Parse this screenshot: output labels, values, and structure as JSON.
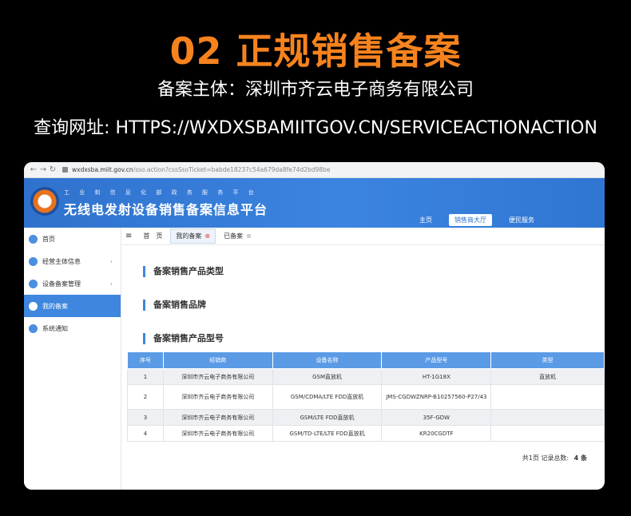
{
  "heading": "02 正规销售备案",
  "entity_line": "备案主体：深圳市齐云电子商务有限公司",
  "query_line": "查询网址: HTTPS://WXDXSBAMIITGOV.CN/SERVICEACTIONACTION",
  "browser": {
    "url_host": "wxdxsba.miit.gov.cn",
    "url_path": "/sso.action?cssSsoTicket=babde18237c54a679da8fe74d2bd98be"
  },
  "banner": {
    "small_text": "工 业 和 信 息 化 部 政 务 服 务 平 台",
    "title": "无线电发射设备销售备案信息平台",
    "nav": [
      "主页",
      "销售商大厅",
      "便民服务"
    ],
    "active_nav": "销售商大厅"
  },
  "sidebar": {
    "items": [
      {
        "label": "首页"
      },
      {
        "label": "经营主体信息"
      },
      {
        "label": "设备备案管理"
      },
      {
        "label": "我的备案"
      },
      {
        "label": "系统通知"
      }
    ]
  },
  "tabs": [
    "首　页",
    "我的备案",
    "已备案"
  ],
  "sections": [
    "备案销售产品类型",
    "备案销售品牌",
    "备案销售产品型号"
  ],
  "table": {
    "headers": [
      "序号",
      "经销商",
      "设备名称",
      "产品型号",
      "类型"
    ],
    "rows": [
      [
        "1",
        "深圳市齐云电子商务有限公司",
        "GSM直放机",
        "HT-1G18X",
        "直放机"
      ],
      [
        "2",
        "深圳市齐云电子商务有限公司",
        "GSM/CDMA/LTE FDD直放机",
        "JMS-CGDWZNRP-B10257560-P27/43",
        ""
      ],
      [
        "3",
        "深圳市齐云电子商务有限公司",
        "GSM/LTE FDD直放机",
        "35F-GDW",
        ""
      ],
      [
        "4",
        "深圳市齐云电子商务有限公司",
        "GSM/TD-LTE/LTE FDD直放机",
        "KR20CGDTF",
        ""
      ]
    ]
  },
  "footer": {
    "pages": "共1页",
    "total_label": "记录总数:",
    "total": "4 条"
  },
  "colors": {
    "heading": "#f7831e",
    "banner": "#3b84e0",
    "accent": "#3e86de"
  }
}
